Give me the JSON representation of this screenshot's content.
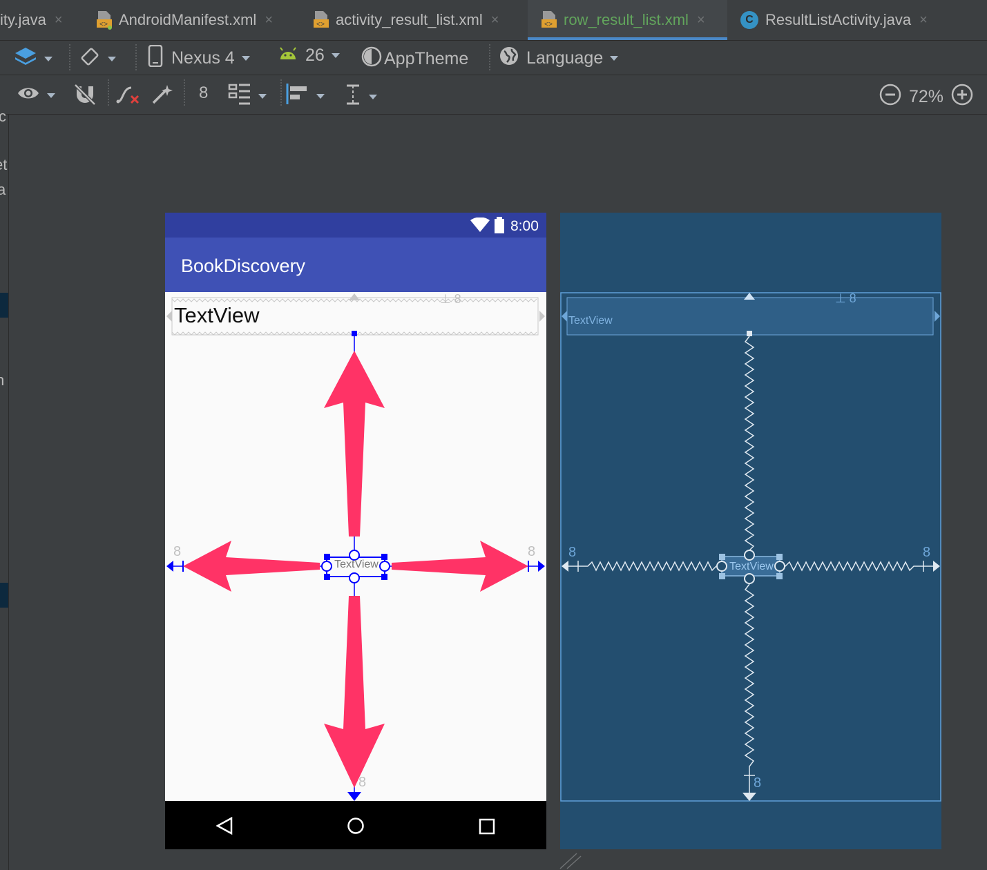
{
  "tabs": [
    {
      "label": "ity.java"
    },
    {
      "label": "AndroidManifest.xml"
    },
    {
      "label": "activity_result_list.xml"
    },
    {
      "label": "row_result_list.xml"
    },
    {
      "label": "ResultListActivity.java"
    }
  ],
  "tab_close_glyph": "×",
  "class_badge": "C",
  "toolbar": {
    "device": "Nexus 4",
    "api": "26",
    "theme": "AppTheme",
    "language": "Language",
    "margin_default": "8",
    "zoom": "72%"
  },
  "phone": {
    "time": "8:00",
    "app_title": "BookDiscovery",
    "textview_top": "TextView",
    "textview_center": "TextView"
  },
  "blueprint": {
    "textview_top": "TextView",
    "textview_center": "TextView"
  },
  "margins": {
    "left": "8",
    "right": "8",
    "top": "8",
    "bottom": "8"
  },
  "left_panel_fragments": [
    "c",
    "et",
    "a",
    "n"
  ],
  "colors": {
    "ide_bg": "#3c3f41",
    "active_tab_text": "#62a55c",
    "status_bar": "#303f9f",
    "app_bar": "#3f51b5",
    "blueprint": "#234e6f",
    "arrow": "#ff3366",
    "constraint": "#0000ff"
  }
}
